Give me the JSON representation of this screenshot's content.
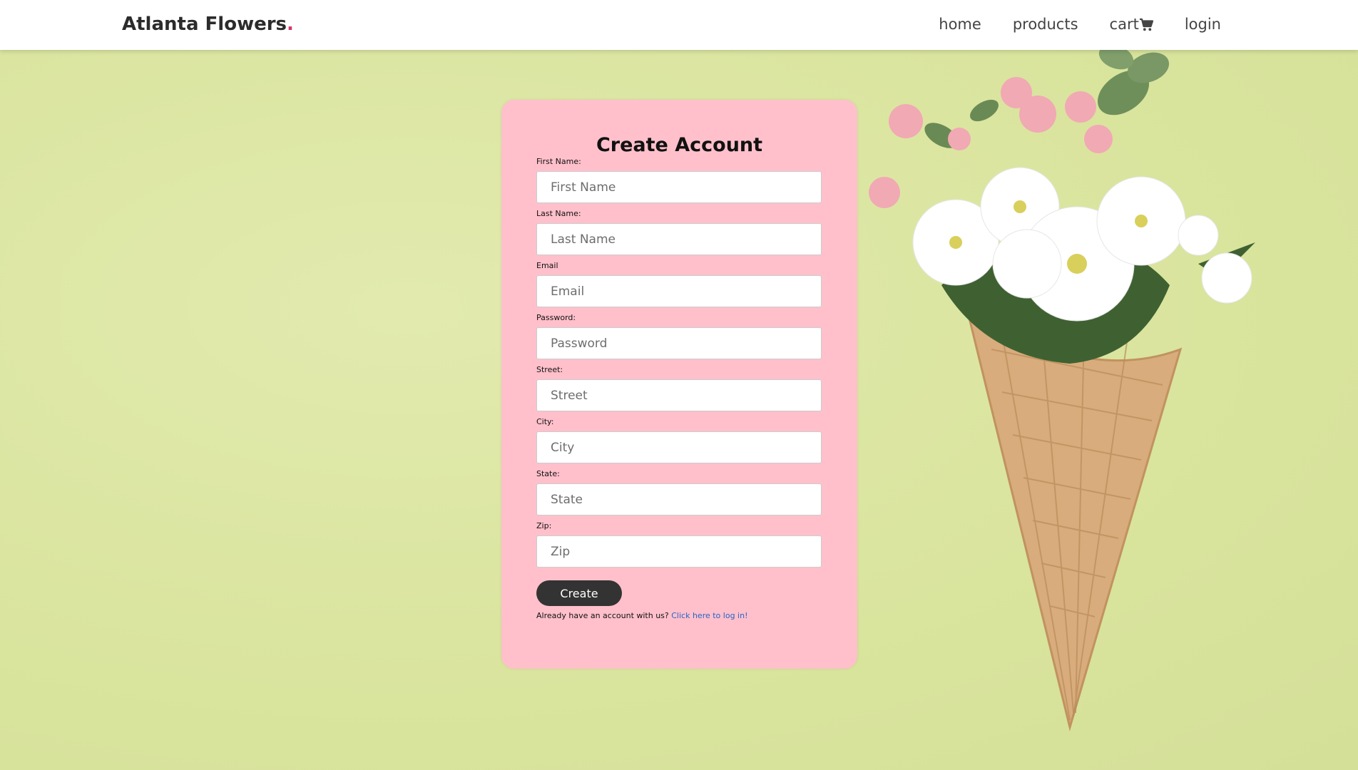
{
  "header": {
    "brand": "Atlanta Flowers",
    "brand_dot": ".",
    "nav": {
      "home": "home",
      "products": "products",
      "cart": "cart",
      "login": "login"
    }
  },
  "form": {
    "title": "Create Account",
    "fields": [
      {
        "label": "First Name:",
        "placeholder": "First Name",
        "value": ""
      },
      {
        "label": "Last Name:",
        "placeholder": "Last Name",
        "value": ""
      },
      {
        "label": "Email",
        "placeholder": "Email",
        "value": ""
      },
      {
        "label": "Password:",
        "placeholder": "Password",
        "value": ""
      },
      {
        "label": "Street:",
        "placeholder": "Street",
        "value": ""
      },
      {
        "label": "City:",
        "placeholder": "City",
        "value": ""
      },
      {
        "label": "State:",
        "placeholder": "State",
        "value": ""
      },
      {
        "label": "Zip:",
        "placeholder": "Zip",
        "value": ""
      }
    ],
    "submit_label": "Create",
    "login_prompt": "Already have an account with us?",
    "login_link": "Click here to log in!"
  },
  "colors": {
    "background": "#dde6a5",
    "card": "#ffc0cb",
    "brand_dot": "#d6336c",
    "button": "#333333",
    "link": "#2962c7"
  },
  "icons": {
    "cart": "shopping-cart-icon"
  }
}
